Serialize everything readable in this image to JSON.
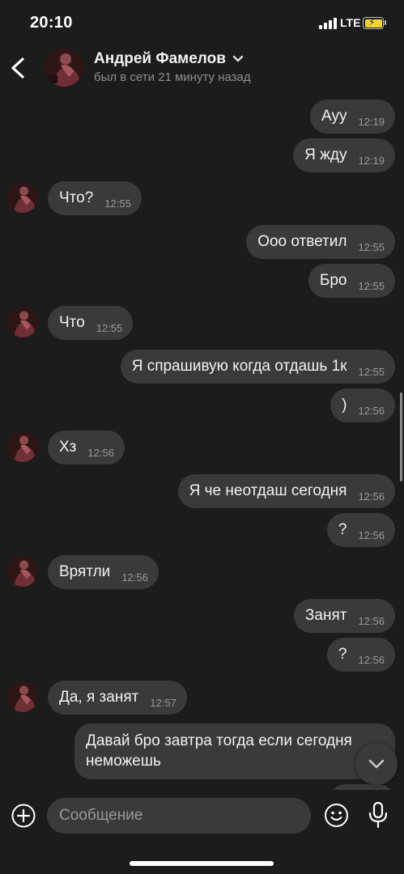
{
  "status_bar": {
    "time": "20:10",
    "network": "LTE",
    "battery_color": "#f2d337"
  },
  "header": {
    "contact_name": "Андрей Фамелов",
    "status": "был в сети 21 минуту назад",
    "back_icon": "chevron-left-icon",
    "name_menu_icon": "chevron-down-icon"
  },
  "messages": [
    {
      "dir": "out",
      "text": "Ауу",
      "time": "12:19"
    },
    {
      "dir": "out",
      "text": "Я жду",
      "time": "12:19"
    },
    {
      "dir": "in",
      "text": "Что?",
      "time": "12:55"
    },
    {
      "dir": "out",
      "text": "Ооо ответил",
      "time": "12:55"
    },
    {
      "dir": "out",
      "text": "Бро",
      "time": "12:55"
    },
    {
      "dir": "in",
      "text": "Что",
      "time": "12:55"
    },
    {
      "dir": "out",
      "text": "Я спрашивую когда отдашь 1к",
      "time": "12:55"
    },
    {
      "dir": "out",
      "text": ")",
      "time": "12:56"
    },
    {
      "dir": "in",
      "text": "Хз",
      "time": "12:56"
    },
    {
      "dir": "out",
      "text": "Я че неотдаш сегодня",
      "time": "12:56"
    },
    {
      "dir": "out",
      "text": "?",
      "time": "12:56"
    },
    {
      "dir": "in",
      "text": "Врятли",
      "time": "12:56"
    },
    {
      "dir": "out",
      "text": "Занят",
      "time": "12:56"
    },
    {
      "dir": "out",
      "text": "?",
      "time": "12:56"
    },
    {
      "dir": "in",
      "text": "Да, я занят",
      "time": "12:57"
    },
    {
      "dir": "out",
      "text": "Давай бро завтра тогда если сегодня неможешь",
      "time": ""
    }
  ],
  "input": {
    "placeholder": "Сообщение"
  },
  "colors": {
    "background": "#1c1c1c",
    "bubble": "#3a3a3c",
    "time_text": "#9a9a9e"
  }
}
